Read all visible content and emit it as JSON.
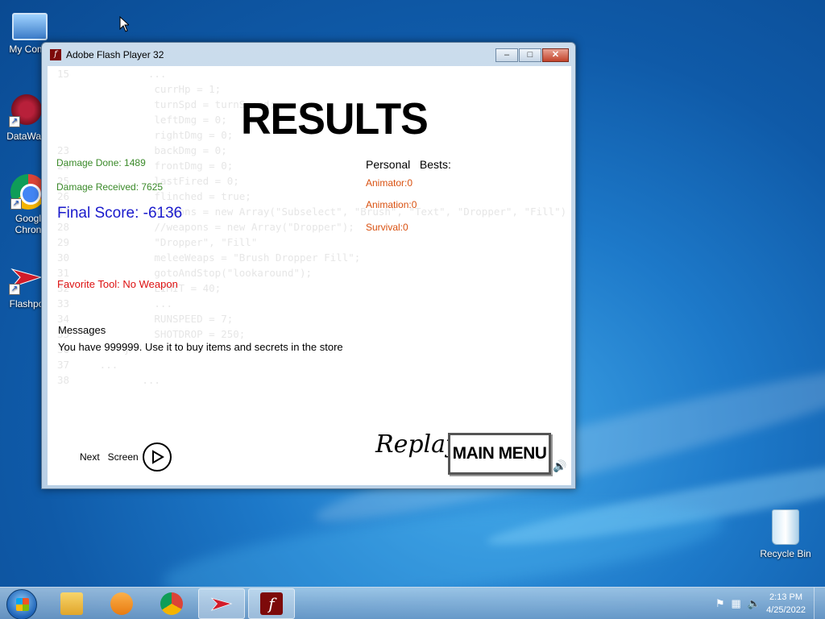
{
  "desktop": {
    "icons": [
      {
        "label": "My Comp",
        "icon": "computer-icon"
      },
      {
        "label": "DataWag",
        "icon": "datawag-icon"
      },
      {
        "label": "Googl\nChron",
        "icon": "chrome-icon"
      },
      {
        "label": "Flashpo",
        "icon": "flashpoint-icon"
      },
      {
        "label": "Recycle Bin",
        "icon": "recycle-bin-icon"
      }
    ]
  },
  "window": {
    "title": "Adobe Flash Player 32",
    "buttons": {
      "minimize": "–",
      "maximize": "□",
      "close": "✕"
    }
  },
  "game": {
    "title": "RESULTS",
    "damage_done": "Damage Done: 1489",
    "damage_received": "Damage Received: 7625",
    "final_score": "Final Score: -6136",
    "favorite_tool": "Favorite Tool: No Weapon",
    "personal_bests_heading": "Personal   Bests:",
    "personal_bests": [
      "Animator:0",
      "Animation:0",
      "Survival:0"
    ],
    "messages_heading": "Messages",
    "message": "You have 999999. Use it to buy items and secrets in the store",
    "next_screen": "Next   Screen",
    "replay": "Replay?",
    "main_menu": "MAIN MENU",
    "code_lines": [
      "15             ...",
      "",
      "",
      "",
      "                currHp = 1;",
      "                turnSpd = turnSpeed;",
      "                leftDmg = 0;",
      "                rightDmg = 0;",
      "23              backDmg = 0;",
      "24              frontDmg = 0;",
      "25              lastFired = 0;",
      "26              flinched = true;",
      "27              weapons = new Array(\"Subselect\", \"Brush\", \"Text\", \"Dropper\", \"Fill\")",
      "28              //weapons = new Array(\"Dropper\");",
      "29              \"Dropper\", \"Fill\"",
      "30              meleeWeaps = \"Brush Dropper Fill\";",
      "31              gotoAndStop(\"lookaround\");",
      "32              LIMIT = 40;",
      "33              ...",
      "34              RUNSPEED = 7;",
      "35              SHOTDROP = 250;",
      "36         }",
      "37     ...",
      "38            ..."
    ]
  },
  "taskbar": {
    "clock_time": "2:13 PM",
    "clock_date": "4/25/2022",
    "apps": [
      "file-explorer-icon",
      "media-player-icon",
      "chrome-icon",
      "flashpoint-icon",
      "flash-player-icon"
    ]
  },
  "colors": {
    "damage": "#3b8a2a",
    "final_score": "#1a1acc",
    "favorite_tool": "#dd1111",
    "personal_best": "#d9500f"
  }
}
